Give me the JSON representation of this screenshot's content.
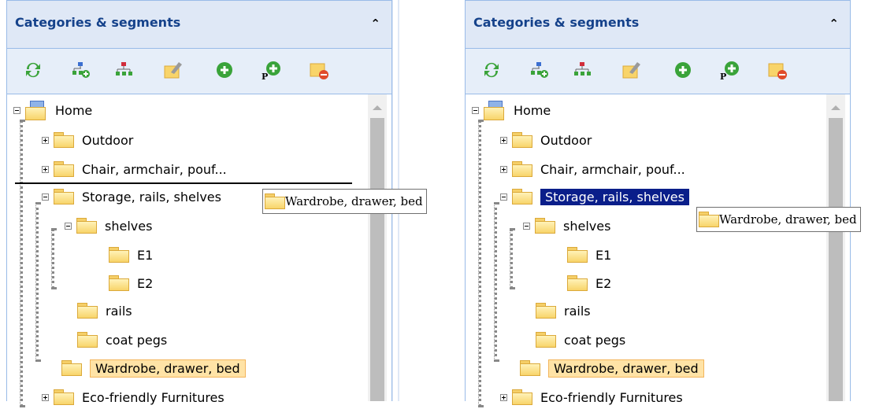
{
  "panels": [
    {
      "header": {
        "title": "Categories & segments"
      },
      "tree": {
        "root": "Home",
        "nodes": [
          "Outdoor",
          "Chair, armchair, pouf...",
          "Storage, rails, shelves",
          "shelves",
          "E1",
          "E2",
          "rails",
          "coat pegs",
          "Wardrobe, drawer, bed",
          "Eco-friendly Furnitures"
        ]
      },
      "drag_ghost": "Wardrobe, drawer, bed"
    },
    {
      "header": {
        "title": "Categories & segments"
      },
      "tree": {
        "root": "Home",
        "nodes": [
          "Outdoor",
          "Chair, armchair, pouf...",
          "Storage, rails, shelves",
          "shelves",
          "E1",
          "E2",
          "rails",
          "coat pegs",
          "Wardrobe, drawer, bed",
          "Eco-friendly Furnitures"
        ]
      },
      "drag_ghost": "Wardrobe, drawer, bed"
    }
  ],
  "icons": {
    "collapse": "chevron-up-icon",
    "toolbar": [
      "refresh-icon",
      "add-node-icon",
      "remove-node-icon",
      "edit-icon",
      "add-icon",
      "add-p-icon",
      "remove-folder-icon"
    ]
  },
  "colors": {
    "selection": "#0a1e8a",
    "highlight": "#ffe3a6",
    "header": "#dfe8f6"
  }
}
